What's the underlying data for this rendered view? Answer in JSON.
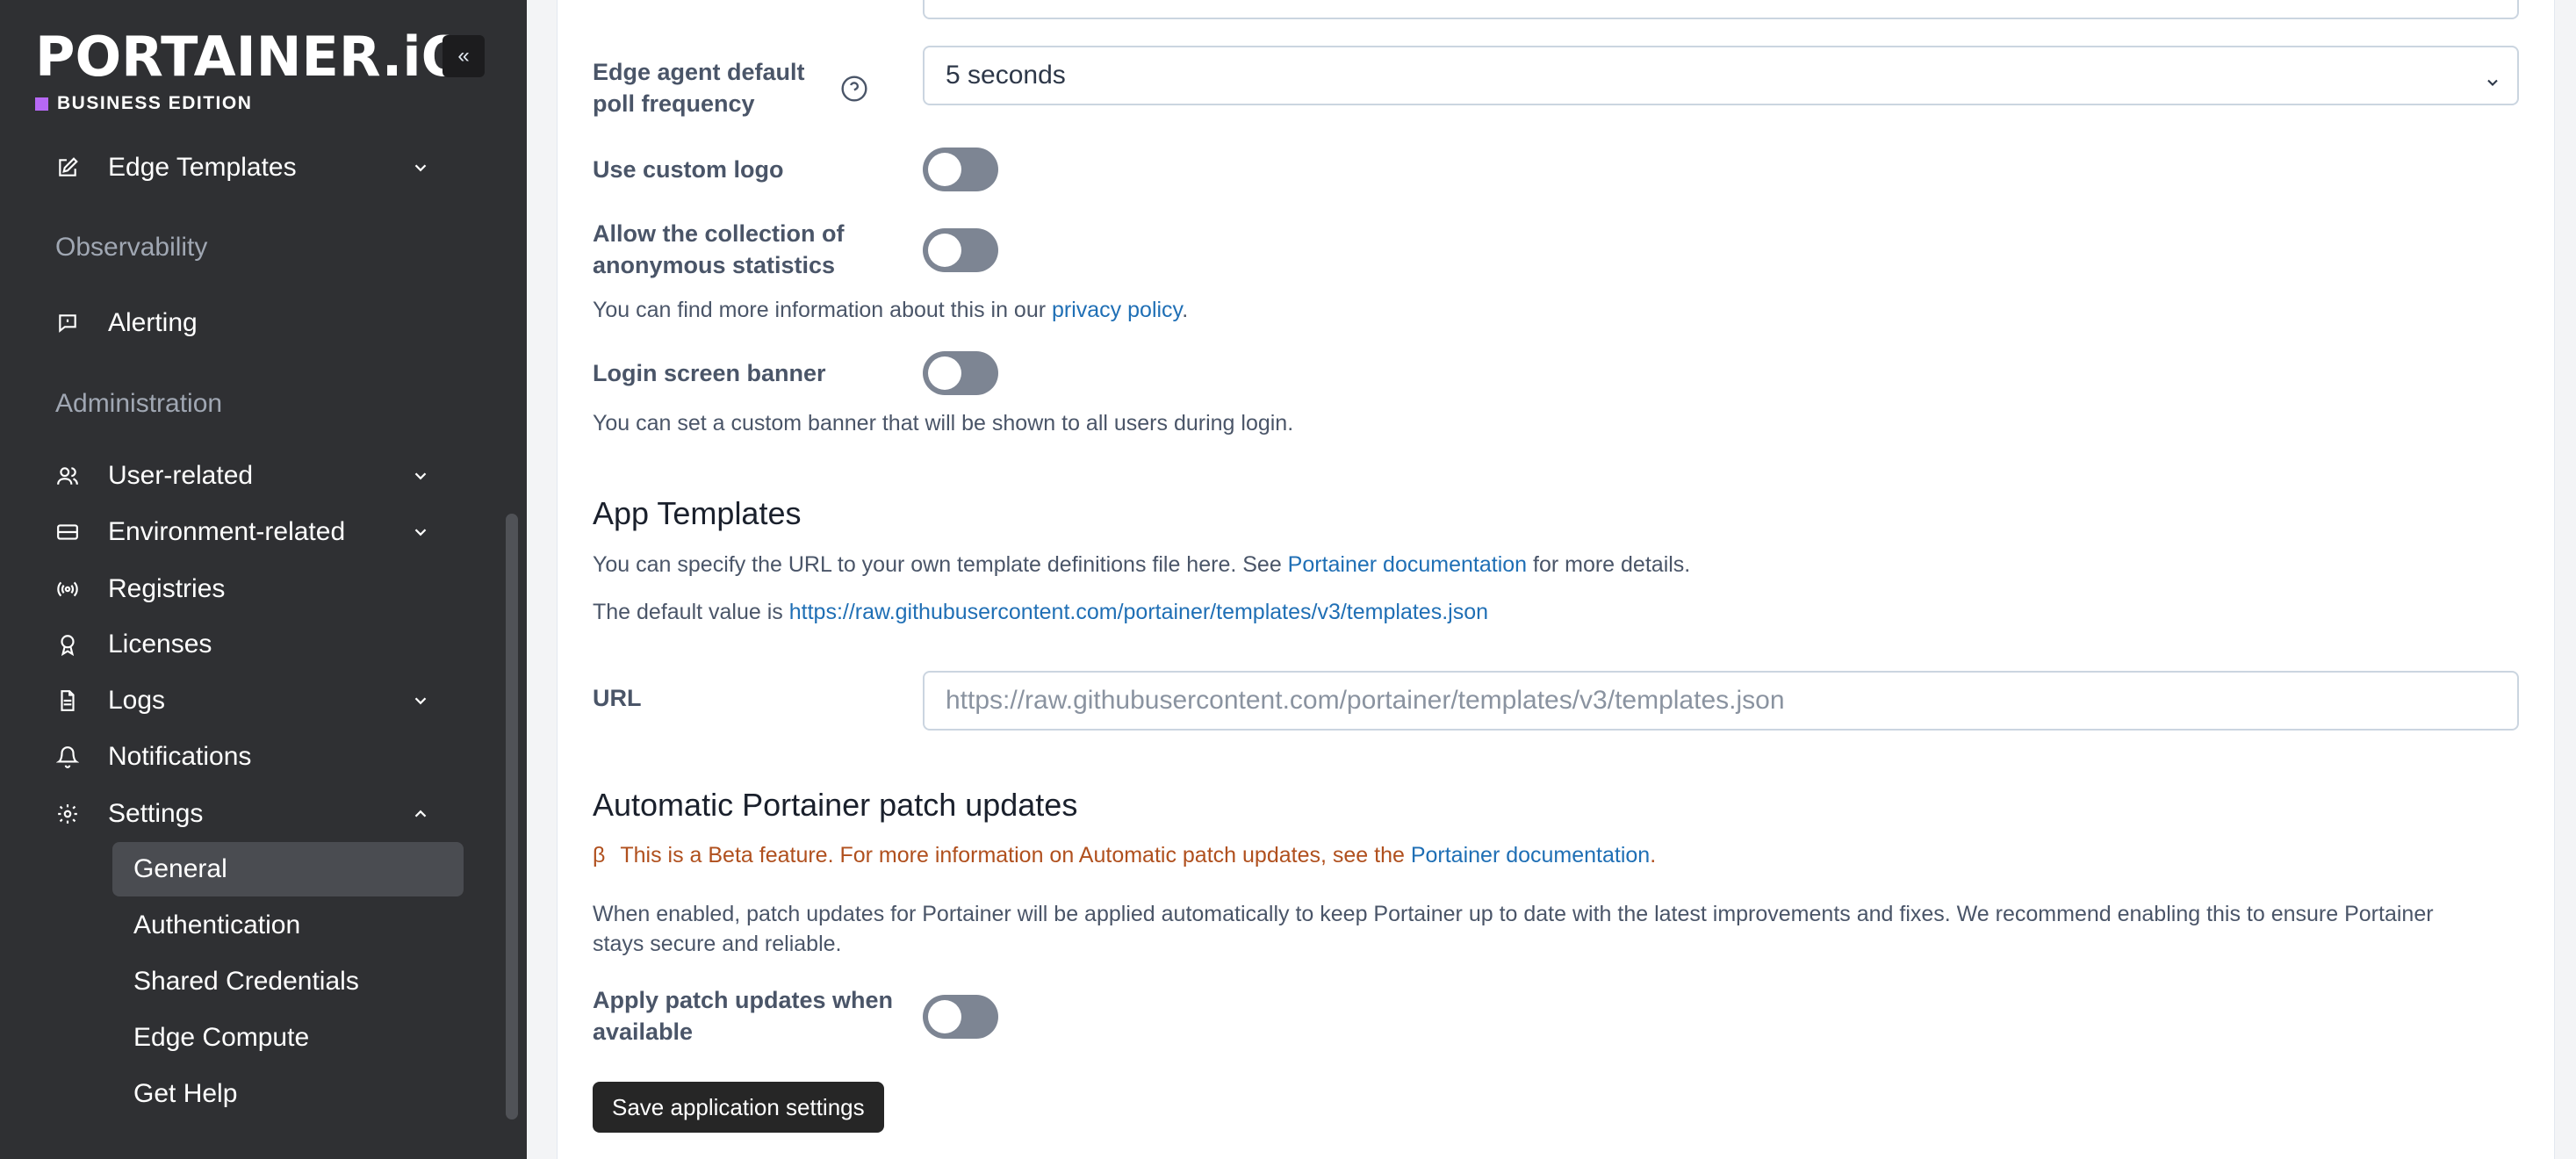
{
  "brand": {
    "logo": "PORTAINER.iO",
    "edition": "BUSINESS EDITION",
    "collapse": "«"
  },
  "sidebar": {
    "edge_templates": "Edge Templates",
    "observability": "Observability",
    "alerting": "Alerting",
    "administration": "Administration",
    "user_related": "User-related",
    "environment_related": "Environment-related",
    "registries": "Registries",
    "licenses": "Licenses",
    "logs": "Logs",
    "notifications": "Notifications",
    "settings": "Settings",
    "settings_items": [
      "General",
      "Authentication",
      "Shared Credentials",
      "Edge Compute",
      "Get Help"
    ]
  },
  "form": {
    "poll_label_line1": "Edge agent default",
    "poll_label_line2": "poll frequency",
    "poll_value": "5 seconds",
    "custom_logo_label": "Use custom logo",
    "stats_label_line1": "Allow the collection of",
    "stats_label_line2": "anonymous statistics",
    "stats_help_prefix": "You can find more information about this in our ",
    "stats_help_link": "privacy policy",
    "stats_help_suffix": ".",
    "banner_label": "Login screen banner",
    "banner_help": "You can set a custom banner that will be shown to all users during login."
  },
  "app_templates": {
    "heading": "App Templates",
    "help_prefix": "You can specify the URL to your own template definitions file here. See ",
    "help_link": "Portainer documentation",
    "help_suffix": " for more details.",
    "default_prefix": "The default value is ",
    "default_link": "https://raw.githubusercontent.com/portainer/templates/v3/templates.json",
    "url_label": "URL",
    "url_placeholder": "https://raw.githubusercontent.com/portainer/templates/v3/templates.json"
  },
  "patch": {
    "heading": "Automatic Portainer patch updates",
    "beta_symbol": "β",
    "beta_text": "This is a Beta feature. For more information on Automatic patch updates, see the ",
    "beta_link": "Portainer documentation",
    "beta_suffix": ".",
    "description_line1": "When enabled, patch updates for Portainer will be applied automatically to keep Portainer up to date with the latest improvements and fixes. We recommend enabling this to ensure Portainer",
    "description_line2": "stays secure and reliable.",
    "apply_label_line1": "Apply patch updates when",
    "apply_label_line2": "available",
    "save_button": "Save application settings"
  },
  "colors": {
    "sidebar_bg": "#2f3033",
    "link": "#1f6fb5",
    "beta": "#b0501e",
    "edition_square": "#b668f5",
    "toggle_off": "#7d8593"
  }
}
